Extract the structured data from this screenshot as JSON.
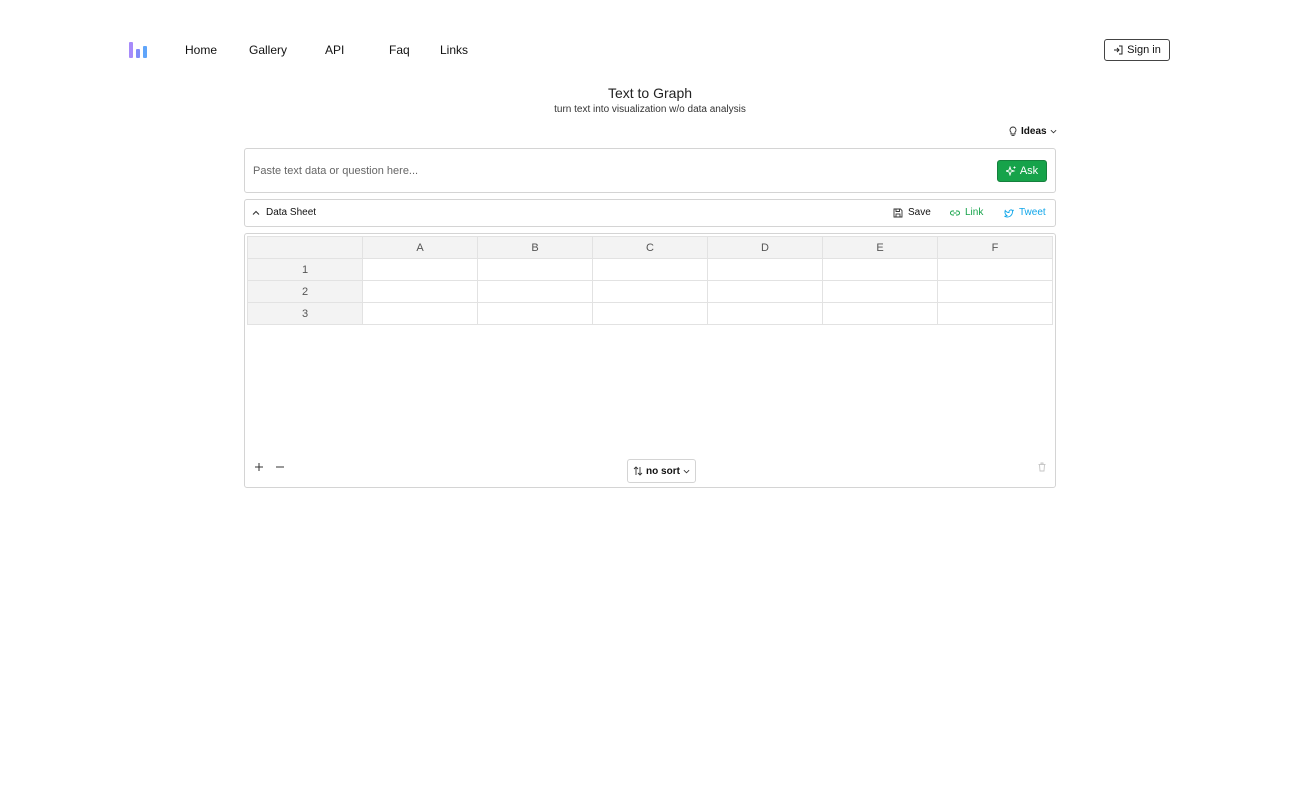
{
  "nav": {
    "logo_icon": "bar-chart-logo-icon",
    "items": [
      {
        "label": "Home"
      },
      {
        "label": "Gallery"
      },
      {
        "label": "API"
      },
      {
        "label": "Faq"
      },
      {
        "label": "Links"
      }
    ],
    "sign_in_label": "Sign in",
    "sign_in_icon": "sign-in-icon"
  },
  "hero": {
    "title": "Text to Graph",
    "subtitle": "turn text into visualization w/o data analysis"
  },
  "ideas": {
    "label": "Ideas",
    "icon": "lightbulb-icon"
  },
  "ask": {
    "placeholder": "Paste text data or question here...",
    "value": "",
    "button_label": "Ask",
    "button_icon": "sparkle-icon",
    "button_color": "#16a34a"
  },
  "sheet": {
    "toggle_label": "Data Sheet",
    "save_label": "Save",
    "link_label": "Link",
    "tweet_label": "Tweet",
    "link_color": "#16a34a",
    "tweet_color": "#0ea5e9"
  },
  "table": {
    "columns": [
      "A",
      "B",
      "C",
      "D",
      "E",
      "F"
    ],
    "rows": [
      {
        "label": "1",
        "cells": [
          "",
          "",
          "",
          "",
          "",
          ""
        ]
      },
      {
        "label": "2",
        "cells": [
          "",
          "",
          "",
          "",
          "",
          ""
        ]
      },
      {
        "label": "3",
        "cells": [
          "",
          "",
          "",
          "",
          "",
          ""
        ]
      }
    ]
  },
  "footer": {
    "sort_label": "no sort",
    "sort_icon": "sort-arrows-icon"
  }
}
